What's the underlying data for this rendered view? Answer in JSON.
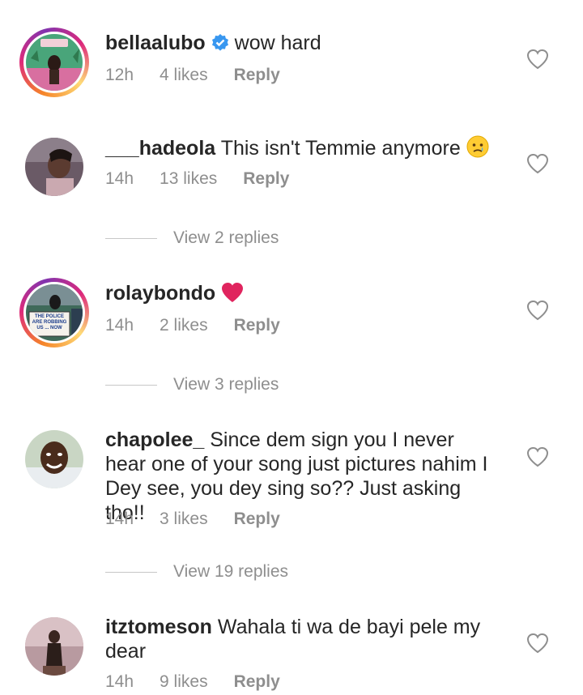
{
  "comments": [
    {
      "username": "bellaalubo",
      "verified": true,
      "text": "wow hard",
      "time": "12h",
      "likes": "4 likes",
      "reply": "Reply"
    },
    {
      "username": "___hadeola",
      "text": "This isn't Temmie anymore",
      "time": "14h",
      "likes": "13 likes",
      "reply": "Reply",
      "view_replies": "View 2 replies"
    },
    {
      "username": "rolaybondo",
      "text": "",
      "time": "14h",
      "likes": "2 likes",
      "reply": "Reply",
      "view_replies": "View 3 replies",
      "avatar_sign_text": "THE POLICE ARE ROBBING US ... NOW"
    },
    {
      "username": "chapolee_",
      "text": "Since dem sign you I never hear one of your song just pictures nahim I Dey see, you dey sing so?? Just asking tho!!",
      "time": "14h",
      "likes": "3 likes",
      "reply": "Reply",
      "view_replies": "View 19 replies"
    },
    {
      "username": "itztomeson",
      "text": "Wahala ti wa de bayi pele my dear",
      "time": "14h",
      "likes": "9 likes",
      "reply": "Reply"
    }
  ],
  "colors": {
    "verified_blue": "#3897f0",
    "heart_red": "#e0245e",
    "meta_gray": "#8e8e8e"
  },
  "icons": {
    "like": "heart-outline-icon",
    "verified": "verified-badge-icon",
    "emoji_sad": "crying-face-emoji",
    "emoji_heart": "red-heart-emoji"
  }
}
